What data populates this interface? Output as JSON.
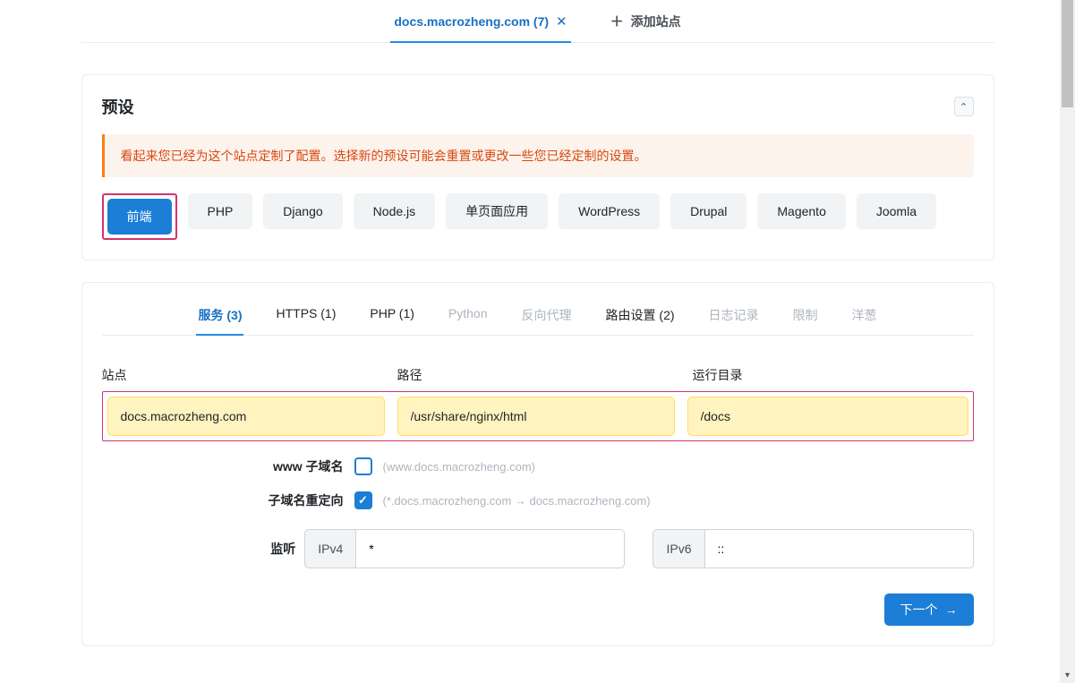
{
  "topTabs": {
    "activeLabel": "docs.macrozheng.com (7)",
    "addLabel": "添加站点"
  },
  "presets": {
    "title": "预设",
    "warning": "看起来您已经为这个站点定制了配置。选择新的预设可能会重置或更改一些您已经定制的设置。",
    "items": [
      "前端",
      "PHP",
      "Django",
      "Node.js",
      "单页面应用",
      "WordPress",
      "Drupal",
      "Magento",
      "Joomla"
    ]
  },
  "subTabs": {
    "service": "服务 (3)",
    "https": "HTTPS (1)",
    "php": "PHP (1)",
    "python": "Python",
    "proxy": "反向代理",
    "routing": "路由设置 (2)",
    "logging": "日志记录",
    "limit": "限制",
    "onion": "洋葱"
  },
  "form": {
    "siteLabel": "站点",
    "pathLabel": "路径",
    "runtimeLabel": "运行目录",
    "siteValue": "docs.macrozheng.com",
    "pathValue": "/usr/share/nginx/html",
    "runtimeValue": "/docs",
    "wwwLabel": "www 子域名",
    "wwwHint": "(www.docs.macrozheng.com)",
    "redirectLabel": "子域名重定向",
    "redirectHint": "(*.docs.macrozheng.com → docs.macrozheng.com)",
    "listenLabel": "监听",
    "ipv4Label": "IPv4",
    "ipv4Value": "*",
    "ipv6Label": "IPv6",
    "ipv6Value": "::"
  },
  "buttons": {
    "next": "下一个"
  }
}
